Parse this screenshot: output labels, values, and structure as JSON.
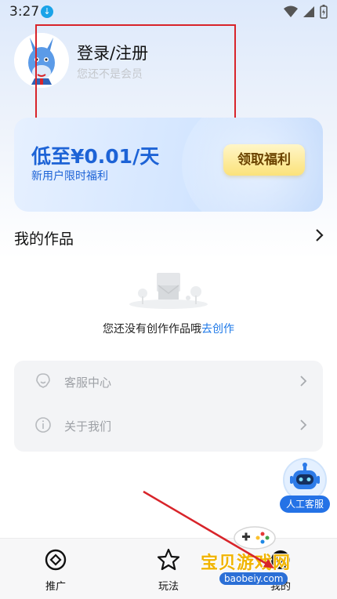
{
  "status_bar": {
    "time": "3:27"
  },
  "profile": {
    "title": "登录/注册",
    "subtitle": "您还不是会员"
  },
  "promo": {
    "price": "低至¥0.01/天",
    "subtitle": "新用户限时福利",
    "button_label": "领取福利"
  },
  "works": {
    "title": "我的作品",
    "empty_text": "您还没有创作作品哦",
    "empty_link": "去创作"
  },
  "menu": {
    "items": [
      {
        "label": "客服中心",
        "icon": "headset-icon"
      },
      {
        "label": "关于我们",
        "icon": "info-icon"
      }
    ]
  },
  "cs_float": {
    "label": "人工客服",
    "icon": "robot-icon"
  },
  "tab_bar": {
    "tabs": [
      {
        "label": "推广",
        "icon": "target-icon"
      },
      {
        "label": "玩法",
        "icon": "star-icon"
      },
      {
        "label": "我的",
        "icon": "profile-icon"
      }
    ]
  },
  "watermark": {
    "text": "宝贝游戏网",
    "url": "baobeiy.com"
  },
  "colors": {
    "accent": "#1d63d6",
    "link": "#1d78e8",
    "button_gold": "#fbe27a",
    "annotation_red": "#d8242a",
    "cs_blue": "#2472e6"
  }
}
